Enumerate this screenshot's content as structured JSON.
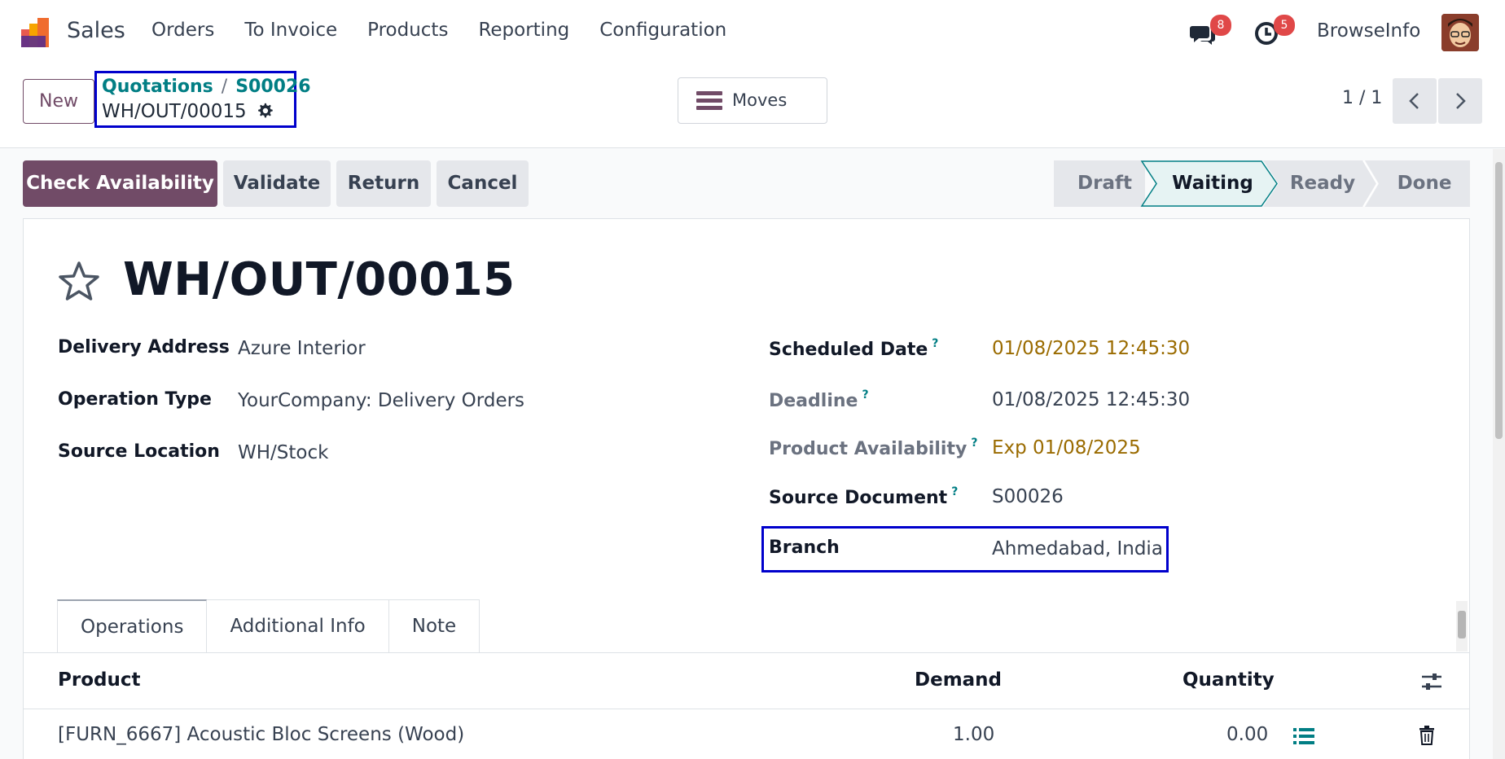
{
  "navbar": {
    "app_name": "Sales",
    "menu": [
      "Orders",
      "To Invoice",
      "Products",
      "Reporting",
      "Configuration"
    ],
    "messages_badge": "8",
    "activities_badge": "5",
    "user_name": "BrowseInfo"
  },
  "control": {
    "new_label": "New",
    "breadcrumb": {
      "parent": "Quotations",
      "separator": "/",
      "child": "S00026",
      "current": "WH/OUT/00015"
    },
    "moves_label": "Moves",
    "pager": "1 / 1"
  },
  "actions": {
    "check_availability": "Check Availability",
    "validate": "Validate",
    "return": "Return",
    "cancel": "Cancel"
  },
  "status": {
    "stages": [
      "Draft",
      "Waiting",
      "Ready",
      "Done"
    ],
    "current": "Waiting"
  },
  "record": {
    "title": "WH/OUT/00015",
    "left_fields": [
      {
        "label": "Delivery Address",
        "value": "Azure Interior"
      },
      {
        "label": "Operation Type",
        "value": "YourCompany: Delivery Orders"
      },
      {
        "label": "Source Location",
        "value": "WH/Stock"
      }
    ],
    "right_fields": [
      {
        "label": "Scheduled Date",
        "help": "?",
        "value": "01/08/2025 12:45:30"
      },
      {
        "label": "Deadline",
        "help": "?",
        "value": "01/08/2025 12:45:30"
      },
      {
        "label": "Product Availability",
        "help": "?",
        "value": "Exp 01/08/2025"
      },
      {
        "label": "Source Document",
        "help": "?",
        "value": "S00026"
      },
      {
        "label": "Branch",
        "value": "Ahmedabad, India"
      }
    ]
  },
  "tabs": [
    "Operations",
    "Additional Info",
    "Note"
  ],
  "table": {
    "headers": {
      "product": "Product",
      "demand": "Demand",
      "quantity": "Quantity"
    },
    "rows": [
      {
        "product": "[FURN_6667] Acoustic Bloc Screens (Wood)",
        "demand": "1.00",
        "quantity": "0.00"
      }
    ]
  },
  "colors": {
    "primary": "#714b67",
    "link": "#017e84",
    "warning_text": "#9a6b00",
    "highlight_box": "#0000cc",
    "badge": "#e04848"
  }
}
